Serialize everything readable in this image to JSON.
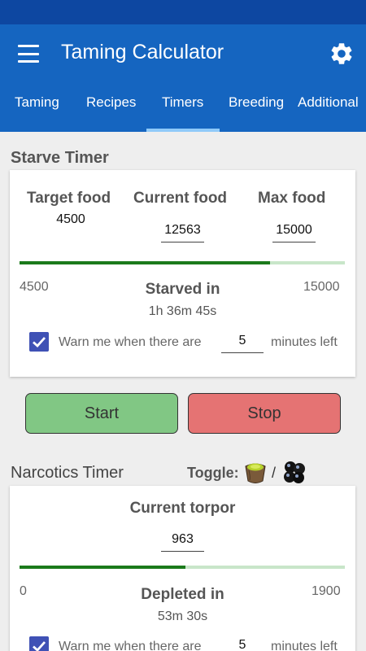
{
  "app": {
    "title": "Taming Calculator",
    "colors": {
      "primary": "#1565c0",
      "status_bar": "#0d47a1",
      "tab_indicator": "#90caf9",
      "progress": "#1b7a1b",
      "start": "#81c784",
      "stop": "#e57373",
      "checkbox": "#3f51b5"
    }
  },
  "icons": {
    "menu": "hamburger-menu-icon",
    "settings": "gear-icon",
    "checkbox": "checkbox-checked-icon",
    "narcotic": "narcotic-icon",
    "berry": "narcoberry-icon"
  },
  "tabs": [
    {
      "label": "Taming",
      "selected": false
    },
    {
      "label": "Recipes",
      "selected": false
    },
    {
      "label": "Timers",
      "selected": true
    },
    {
      "label": "Breeding",
      "selected": false
    },
    {
      "label": "Additional",
      "selected": false
    }
  ],
  "starve": {
    "title": "Starve Timer",
    "target_label": "Target food",
    "target_value": "4500",
    "current_label": "Current food",
    "current_value": "12563",
    "max_label": "Max food",
    "max_value": "15000",
    "progress_fraction": 0.77,
    "range_min": "4500",
    "range_max": "15000",
    "result_label": "Starved in",
    "result_time": "1h 36m 45s",
    "warn_checked": true,
    "warn_prefix": "Warn me when there are",
    "warn_minutes": "5",
    "warn_suffix": "minutes left"
  },
  "buttons": {
    "start": "Start",
    "stop": "Stop"
  },
  "narcotics": {
    "title": "Narcotics Timer",
    "toggle_label": "Toggle:",
    "toggle_separator": "/",
    "torpor_label": "Current torpor",
    "torpor_value": "963",
    "progress_fraction": 0.51,
    "range_min": "0",
    "range_max": "1900",
    "result_label": "Depleted in",
    "result_time": "53m 30s",
    "warn_checked": true,
    "warn_prefix": "Warn me when there are",
    "warn_minutes": "5",
    "warn_suffix": "minutes left"
  }
}
